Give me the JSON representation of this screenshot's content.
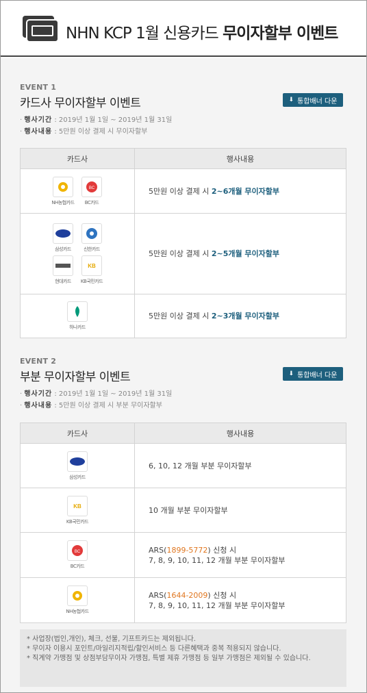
{
  "header": {
    "icon": "credit-card-icon",
    "title_regular": "NHN KCP 1월 신용카드 ",
    "title_bold": "무이자할부 이벤트"
  },
  "colors": {
    "accent": "#1d5f7d",
    "phone": "#e0761f",
    "header_rule": "#444444"
  },
  "event1": {
    "label": "EVENT 1",
    "title": "카드사 무이자할부 이벤트",
    "download_button": "통합배너 다운",
    "period_key": "행사기간",
    "period_value": "2019년 1월 1일 ~ 2019년 1월 31일",
    "content_key": "행사내용",
    "content_value": "5만원 이상 결제 시 무이자할부",
    "table_headers": [
      "카드사",
      "행사내용"
    ],
    "rows": [
      {
        "cards": [
          "NH농협카드",
          "BC카드"
        ],
        "desc_prefix": "5만원 이상 결제 시 ",
        "desc_highlight": "2~6개월 무이자할부"
      },
      {
        "cards": [
          "삼성카드",
          "신한카드",
          "현대카드",
          "KB국민카드"
        ],
        "desc_prefix": "5만원 이상 결제 시 ",
        "desc_highlight": "2~5개월 무이자할부"
      },
      {
        "cards": [
          "하나카드"
        ],
        "desc_prefix": "5만원 이상 결제 시 ",
        "desc_highlight": "2~3개월 무이자할부"
      }
    ]
  },
  "event2": {
    "label": "EVENT 2",
    "title": "부분 무이자할부 이벤트",
    "download_button": "통합배너 다운",
    "period_key": "행사기간",
    "period_value": "2019년 1월 1일 ~ 2019년 1월 31일",
    "content_key": "행사내용",
    "content_value": "5만원 이상 결제 시 부분 무이자할부",
    "table_headers": [
      "카드사",
      "행사내용"
    ],
    "rows": [
      {
        "card": "삼성카드",
        "line1": "6, 10, 12 개월 부분 무이자할부"
      },
      {
        "card": "KB국민카드",
        "line1": "10 개월 부분 무이자할부"
      },
      {
        "card": "BC카드",
        "ars_prefix": "ARS(",
        "phone": "1899-5772",
        "ars_suffix": ") 신청 시",
        "line2": "7, 8, 9, 10, 11, 12 개월 부분 무이자할부"
      },
      {
        "card": "NH농협카드",
        "ars_prefix": "ARS(",
        "phone": "1644-2009",
        "ars_suffix": ") 신청 시",
        "line2": "7, 8, 9, 10, 11, 12 개월 부분 무이자할부"
      }
    ]
  },
  "notes": [
    "* 사업장(법인,개인), 체크, 선불, 기프트카드는 제외됩니다.",
    "* 무이자 이용시 포인트/마일리지적립/할인서비스 등 다른혜택과 중복 적용되지 않습니다.",
    "* 직계약 가맹점 및 상점부담무이자 가맹점, 특별 제휴 가맹점 등 일부 가맹점은 제외될 수 있습니다."
  ]
}
